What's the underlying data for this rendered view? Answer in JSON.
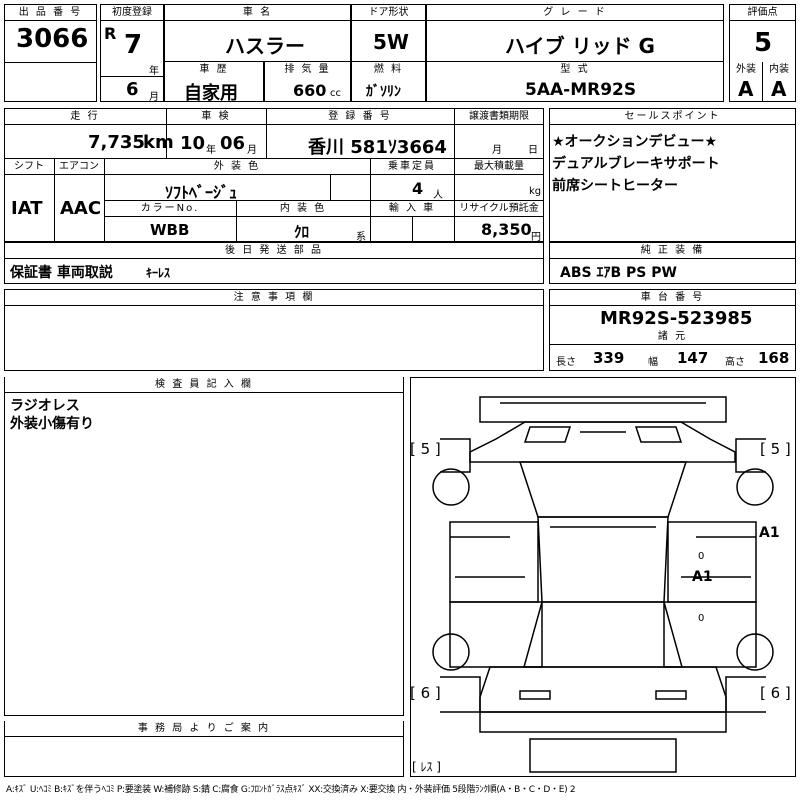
{
  "header": {
    "lot_no_label": "出 品 番 号",
    "lot_no": "3066",
    "first_reg_label": "初度登録",
    "era": "R",
    "first_reg_year": "7",
    "year_unit": "年",
    "first_reg_month": "6",
    "month_unit": "月",
    "car_name_label": "車 名",
    "car_name": "ハスラー",
    "door_label": "ドア形状",
    "door": "5W",
    "grade_label": "グ レ ー ド",
    "grade": "ハイブ リッド G",
    "score_label": "評価点",
    "score": "5",
    "history_label": "車 歴",
    "history": "自家用",
    "displacement_label": "排 気 量",
    "displacement": "660",
    "displacement_unit": "cc",
    "fuel_label": "燃 料",
    "fuel": "ｶﾞｿﾘﾝ",
    "model_label": "型 式",
    "model": "5AA-MR92S",
    "exterior_label": "外装",
    "exterior": "A",
    "interior_label": "内装",
    "interior": "A"
  },
  "row2": {
    "mileage_label": "走 行",
    "mileage": "7,735",
    "mileage_unit": "km",
    "inspection_label": "車 検",
    "inspection_year": "10",
    "inspection_year_unit": "年",
    "inspection_month": "06",
    "inspection_month_unit": "月",
    "plate_label": "登 録 番 号",
    "plate": "香川 581ｿ3664",
    "transfer_label": "譲渡書類期限",
    "transfer_month_unit": "月",
    "transfer_day_unit": "日",
    "shift_label": "シフト",
    "shift": "IAT",
    "ac_label": "エアコン",
    "ac": "AAC",
    "color_label": "外 装 色",
    "color": "ｿﾌﾄﾍﾞｰｼﾞｭ",
    "capacity_label": "乗車定員",
    "capacity": "4",
    "capacity_unit": "人",
    "load_label": "最大積載量",
    "load_unit": "kg",
    "color_no_label": "カラーNo.",
    "color_no": "WBB",
    "interior_color_label": "内 装 色",
    "interior_color": "ｸﾛ",
    "interior_color_unit": "系",
    "import_label": "輸 入 車",
    "recycle_label": "リサイクル預託金",
    "recycle": "8,350",
    "recycle_unit": "円"
  },
  "sales_points": {
    "label": "セールスポイント",
    "lines": [
      "★オークションデビュー★",
      "デュアルブレーキサポート",
      "前席シートヒーター"
    ]
  },
  "later_parts": {
    "label": "後 日 発 送 部 品",
    "value_bold": "保証書 車両取説",
    "value_small": "ｷｰﾚｽ"
  },
  "equipment": {
    "label": "純 正 装 備",
    "value": "ABS ｴｱB PS PW"
  },
  "notes": {
    "label": "注 意 事 項 欄"
  },
  "chassis": {
    "label": "車 台 番 号",
    "value": "MR92S-523985",
    "specs_label": "諸 元",
    "length_label": "長さ",
    "length": "339",
    "width_label": "幅",
    "width": "147",
    "height_label": "高さ",
    "height": "168"
  },
  "inspector": {
    "label": "検 査 員 記 入 欄",
    "lines": [
      "ラジオレス",
      "外装小傷有り"
    ]
  },
  "office": {
    "label": "事 務 局 よ り ご 案 内"
  },
  "diagram": {
    "tread_front_left": "[ 5 ]",
    "tread_front_right": "[ 5 ]",
    "tread_rear_left": "[ 6 ]",
    "tread_rear_right": "[ 6 ]",
    "mark_right_door": "A1",
    "mark_right_front": "A1",
    "mark_zero_1": "0",
    "mark_zero_2": "0",
    "spare": "[ ﾚｽ ]"
  },
  "legend": "A:ｷｽﾞ U:ﾍｺﾐ B:ｷｽﾞを伴うﾍｺﾐ P:要塗装 W:補修跡 S:錆 C:腐食 G:ﾌﾛﾝﾄｶﾞﾗｽ点ｷｽﾞ XX:交換済み X:要交換 内・外装評価 5段階ﾗﾝｸ順(A・B・C・D・E) 2"
}
